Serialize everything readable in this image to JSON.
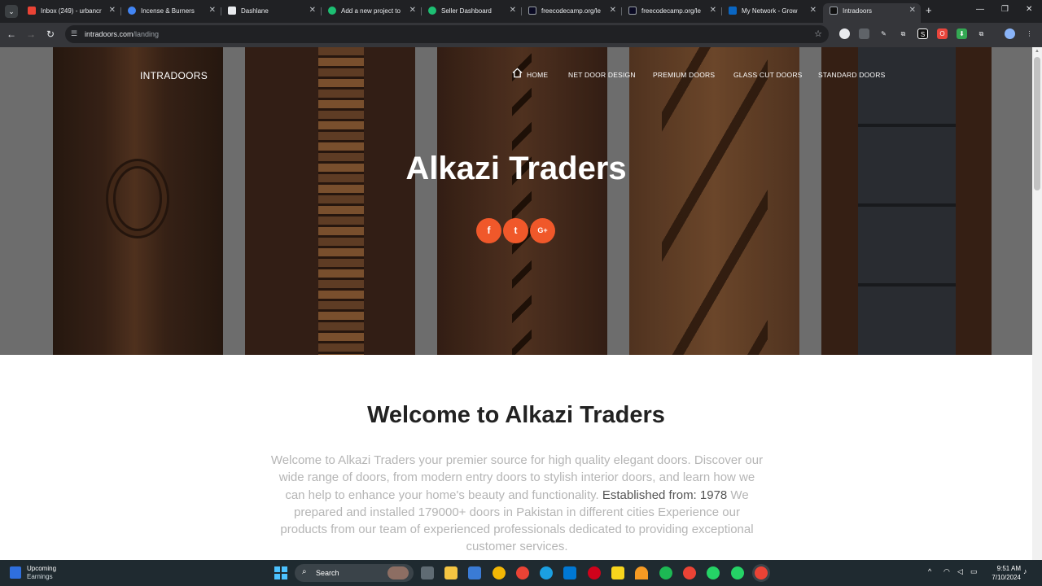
{
  "browser": {
    "tabs": [
      {
        "title": "Inbox (249) - urbancr",
        "icon": "gmail-icon",
        "color": "#ea4335"
      },
      {
        "title": "Incense & Burners",
        "icon": "google-icon",
        "color": "#4285f4"
      },
      {
        "title": "Dashlane",
        "icon": "dashlane-icon",
        "color": "#ffffff"
      },
      {
        "title": "Add a new project to",
        "icon": "fiverr-icon",
        "color": "#1dbf73"
      },
      {
        "title": "Seller Dashboard",
        "icon": "fiverr-icon",
        "color": "#1dbf73"
      },
      {
        "title": "freecodecamp.org/le",
        "icon": "freecodecamp-icon",
        "color": "#0a0a23"
      },
      {
        "title": "freecodecamp.org/le",
        "icon": "freecodecamp-icon",
        "color": "#0a0a23"
      },
      {
        "title": "My Network - Grow",
        "icon": "linkedin-icon",
        "color": "#0a66c2"
      },
      {
        "title": "Intradoors",
        "icon": "intradoors-icon",
        "color": "#111111",
        "active": true
      }
    ],
    "url_host": "intradoors.com",
    "url_path": "/landing"
  },
  "site": {
    "brand": "INTRADOORS",
    "nav": {
      "home": "HOME",
      "net": "NET DOOR DESIGN",
      "premium": "PREMIUM DOORS",
      "glass": "GLASS CUT DOORS",
      "standard": "STANDARD DOORS"
    },
    "hero_title": "Alkazi Traders",
    "social": [
      {
        "icon": "facebook-icon",
        "glyph": "f"
      },
      {
        "icon": "twitter-icon",
        "glyph": "t"
      },
      {
        "icon": "google-plus-icon",
        "glyph": "G+"
      }
    ],
    "accent": "#f0582a",
    "welcome_title": "Welcome to Alkazi Traders",
    "welcome_text_1": "Welcome to Alkazi Traders your premier source for high quality elegant doors. Discover our wide range of doors, from modern entry doors to stylish interior doors, and learn how we can help to enhance your home's beauty and functionality. ",
    "established": "Established from: 1978",
    "welcome_text_2": " We prepared and installed 179000+ doors in Pakistan in different cities Experience our products from our team of experienced professionals dedicated to providing exceptional customer services."
  },
  "taskbar": {
    "weather_line1": "Upcoming",
    "weather_line2": "Earnings",
    "search_label": "Search",
    "time": "9:51 AM",
    "date": "7/10/2024"
  }
}
